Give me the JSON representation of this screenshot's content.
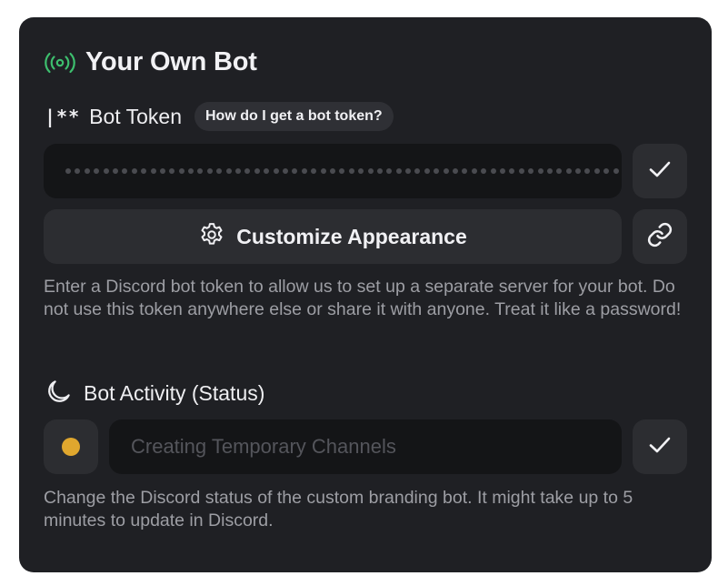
{
  "header": {
    "title": "Your Own Bot",
    "icon": "broadcast-icon",
    "icon_color": "#3dbf6e"
  },
  "token_section": {
    "glyph": "|**",
    "label": "Bot Token",
    "help_link": "How do I get a bot token?",
    "input_value": "••••••••••••••••••••••••••••••••••••••••••••••••••••••••••••",
    "confirm_icon": "checkmark-icon",
    "customize_label": "Customize Appearance",
    "customize_icon": "gear-icon",
    "link_icon": "link-icon",
    "description": "Enter a Discord bot token to allow us to set up a separate server for your bot. Do not use this token anywhere else or share it with anyone. Treat it like a password!"
  },
  "activity_section": {
    "label": "Bot Activity (Status)",
    "icon": "moon-icon",
    "status_color": "#e0a72e",
    "input_placeholder": "Creating Temporary Channels",
    "confirm_icon": "checkmark-icon",
    "description": "Change the Discord status of the custom branding bot. It might take up to 5 minutes to update in Discord."
  }
}
